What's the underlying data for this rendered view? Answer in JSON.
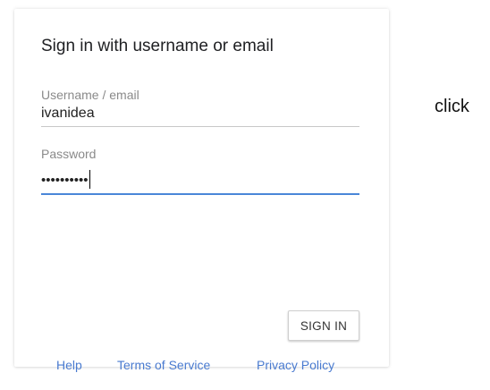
{
  "form": {
    "title": "Sign in with username or email",
    "username": {
      "label": "Username / email",
      "value": "ivanidea"
    },
    "password": {
      "label": "Password",
      "value": "••••••••••"
    },
    "submit_label": "SIGN IN"
  },
  "footer": {
    "help": "Help",
    "terms": "Terms of Service",
    "privacy": "Privacy Policy"
  },
  "annotation": "click",
  "colors": {
    "focus_underline": "#4a86d8",
    "link": "#4a7bd0"
  }
}
